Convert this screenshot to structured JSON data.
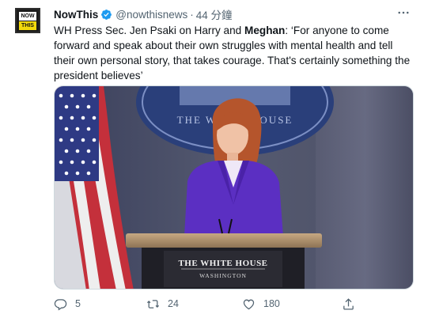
{
  "tweet": {
    "avatar": {
      "logo_top": "NOW",
      "logo_bottom": "THIS"
    },
    "author_name": "NowThis",
    "author_handle": "@nowthisnews",
    "separator": "·",
    "timestamp": "44 分鐘",
    "text_part1": "WH Press Sec. Jen Psaki on Harry and ",
    "text_bold": "Meghan",
    "text_part2": ": ‘For anyone to come forward and speak about their own struggles with mental health and tell their own personal story, that takes courage. That's certainly something the president believes’",
    "media": {
      "podium_line1": "THE WHITE HOUSE",
      "podium_line2": "WASHINGTON",
      "backdrop_text": "THE WHITE HOUSE"
    },
    "reply_count": "5",
    "retweet_count": "24",
    "like_count": "180"
  },
  "colors": {
    "text_primary": "#0f1419",
    "text_secondary": "#536471",
    "verified_blue": "#1d9bf0",
    "backdrop_blue": "#2a3f7a",
    "suit_purple": "#5b2fc2"
  },
  "icons": {
    "verified": "verified-badge-icon",
    "more": "more-icon",
    "reply": "reply-icon",
    "retweet": "retweet-icon",
    "like": "heart-icon",
    "share": "share-icon"
  }
}
